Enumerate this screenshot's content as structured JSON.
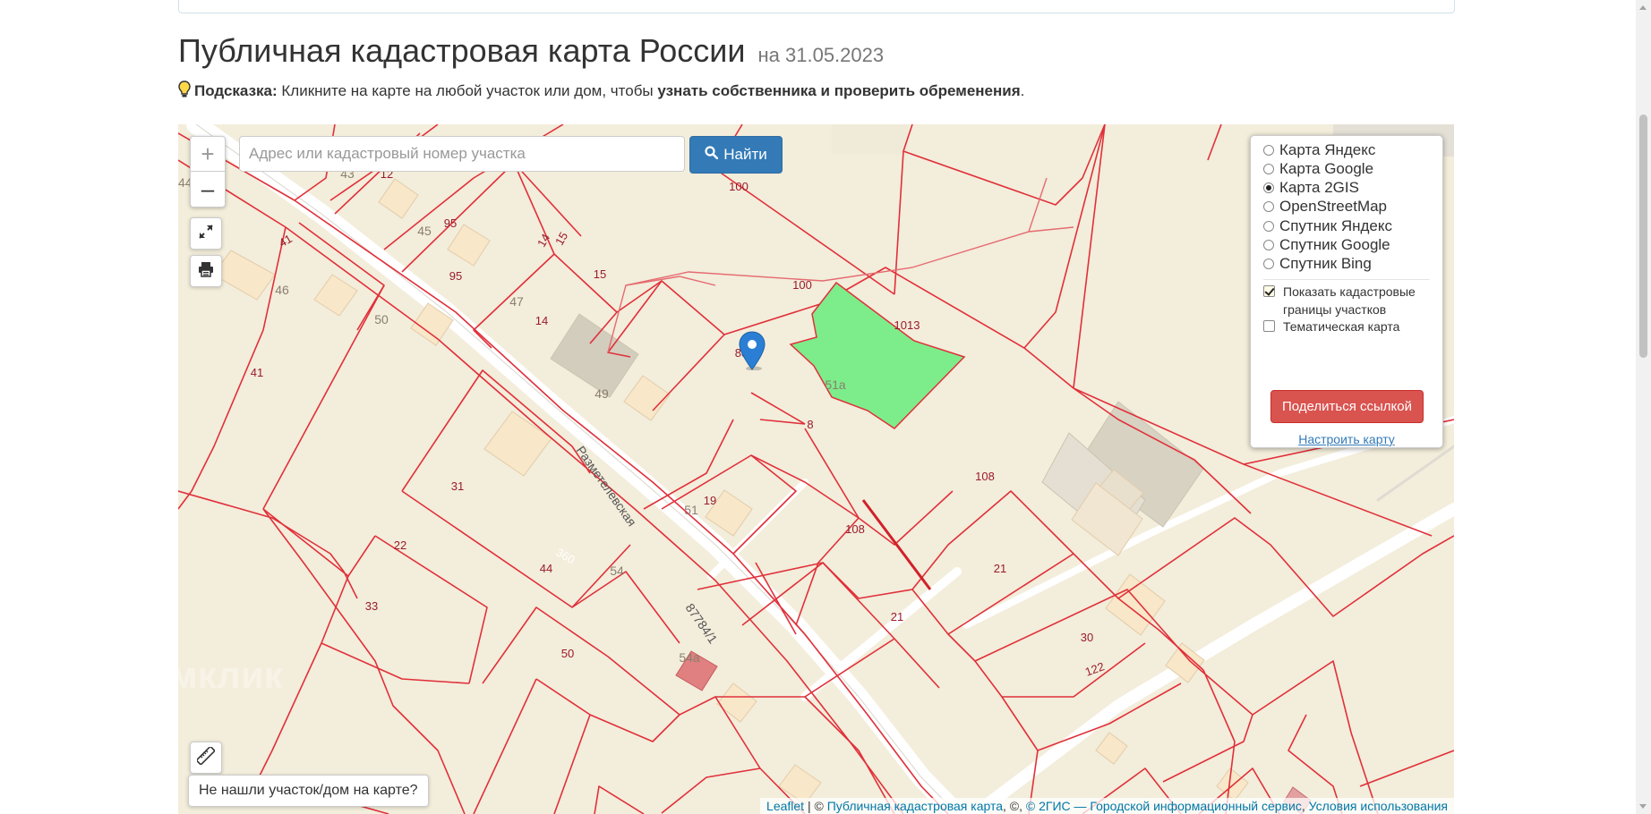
{
  "page": {
    "title": "Публичная кадастровая карта России",
    "date": "на 31.05.2023",
    "hint_label": "Подсказка:",
    "hint_text": " Кликните на карте на любой участок или дом, чтобы ",
    "hint_bold": "узнать собственника и проверить обременения",
    "hint_end": "."
  },
  "search": {
    "placeholder": "Адрес или кадастровый номер участка",
    "button_label": "Найти"
  },
  "zoom": {
    "in": "+",
    "out": "–"
  },
  "layers": {
    "options": [
      {
        "label": "Карта Яндекс",
        "selected": false
      },
      {
        "label": "Карта Google",
        "selected": false
      },
      {
        "label": "Карта 2GIS",
        "selected": true
      },
      {
        "label": "OpenStreetMap",
        "selected": false
      },
      {
        "label": "Спутник Яндекс",
        "selected": false
      },
      {
        "label": "Спутник Google",
        "selected": false
      },
      {
        "label": "Спутник Bing",
        "selected": false
      }
    ],
    "cadastral_borders": "Показать кадастровые границы участков",
    "cadastral_checked": true,
    "thematic_map": "Тематическая карта",
    "thematic_checked": false,
    "share_button": "Поделиться ссылкой",
    "configure_link": "Настроить карту"
  },
  "map": {
    "street_name": "Разметелевская",
    "road_number": "87784/1",
    "plot_labels": [
      "100",
      "100",
      "1013",
      "12",
      "95",
      "95",
      "15",
      "14",
      "14",
      "15",
      "41",
      "41",
      "31",
      "22",
      "33",
      "44",
      "50",
      "19",
      "8",
      "108",
      "108",
      "21",
      "21",
      "30",
      "12",
      "88",
      "44"
    ],
    "building_labels": [
      "43",
      "45",
      "46",
      "50",
      "47",
      "49",
      "51a",
      "51",
      "360",
      "54",
      "54a",
      "122"
    ],
    "watermark": "Домклик",
    "colors": {
      "selected_plot": "#7ced8a",
      "plot_border": "#e0303a",
      "background": "#f3eddb",
      "marker": "#2a7fd4"
    }
  },
  "not_found_button": "Не нашли участок/дом на карте?",
  "attribution": {
    "leaflet": "Leaflet",
    "sep1": " | © ",
    "pkk": "Публичная кадастровая карта",
    "sep2": ", ©, ",
    "gis": "© 2ГИС — Городской информационный сервис",
    "sep3": ", ",
    "terms": "Условия использования"
  }
}
